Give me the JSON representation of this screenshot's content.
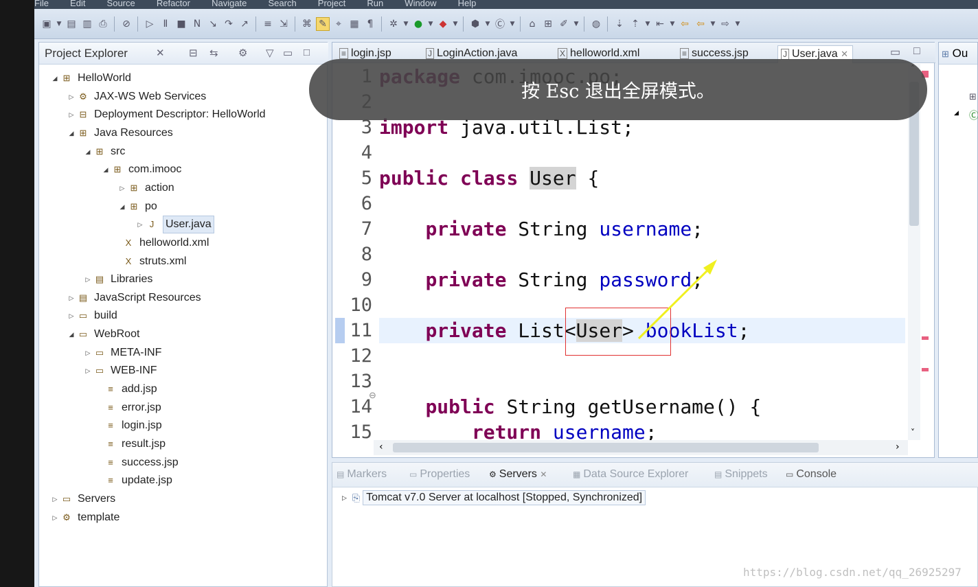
{
  "menubar": {
    "items": [
      "File",
      "Edit",
      "Source",
      "Refactor",
      "Navigate",
      "Search",
      "Project",
      "Run",
      "Window",
      "Help"
    ]
  },
  "project_explorer": {
    "title": "Project Explorer",
    "tree": [
      {
        "label": "HelloWorld",
        "expanded": true
      },
      {
        "label": "JAX-WS Web Services",
        "expanded": false
      },
      {
        "label": "Deployment Descriptor: HelloWorld",
        "expanded": false
      },
      {
        "label": "Java Resources",
        "expanded": true
      },
      {
        "label": "src",
        "expanded": true
      },
      {
        "label": "com.imooc",
        "expanded": true
      },
      {
        "label": "action",
        "expanded": false
      },
      {
        "label": "po",
        "expanded": true
      },
      {
        "label": "User.java",
        "expanded": false,
        "selected": true
      },
      {
        "label": "helloworld.xml"
      },
      {
        "label": "struts.xml"
      },
      {
        "label": "Libraries",
        "expanded": false
      },
      {
        "label": "JavaScript Resources",
        "expanded": false
      },
      {
        "label": "build",
        "expanded": false
      },
      {
        "label": "WebRoot",
        "expanded": true
      },
      {
        "label": "META-INF",
        "expanded": false
      },
      {
        "label": "WEB-INF",
        "expanded": false
      },
      {
        "label": "add.jsp"
      },
      {
        "label": "error.jsp"
      },
      {
        "label": "login.jsp"
      },
      {
        "label": "result.jsp"
      },
      {
        "label": "success.jsp"
      },
      {
        "label": "update.jsp"
      },
      {
        "label": "Servers",
        "expanded": false
      },
      {
        "label": "template",
        "expanded": false
      }
    ]
  },
  "editor": {
    "tabs": [
      "login.jsp",
      "LoginAction.java",
      "helloworld.xml",
      "success.jsp",
      "User.java"
    ],
    "active_tab": "User.java",
    "line_numbers": [
      "1",
      "2",
      "3",
      "4",
      "5",
      "6",
      "7",
      "8",
      "9",
      "10",
      "11",
      "12",
      "13",
      "14",
      "15"
    ],
    "lines": [
      {
        "n": "1",
        "parts": [
          [
            "kw",
            "package"
          ],
          [
            "t",
            " com.imooc.po;"
          ]
        ]
      },
      {
        "n": "2",
        "parts": []
      },
      {
        "n": "3",
        "parts": [
          [
            "kw",
            "import"
          ],
          [
            "t",
            " java.util.List;"
          ]
        ]
      },
      {
        "n": "4",
        "parts": []
      },
      {
        "n": "5",
        "parts": [
          [
            "kw",
            "public"
          ],
          [
            "t",
            " "
          ],
          [
            "kw",
            "class"
          ],
          [
            "t",
            " "
          ],
          [
            "occ",
            "User"
          ],
          [
            "t",
            " {"
          ]
        ]
      },
      {
        "n": "6",
        "parts": []
      },
      {
        "n": "7",
        "parts": [
          [
            "t",
            "    "
          ],
          [
            "kw",
            "private"
          ],
          [
            "t",
            " String "
          ],
          [
            "fld",
            "username"
          ],
          [
            "t",
            ";"
          ]
        ]
      },
      {
        "n": "8",
        "parts": []
      },
      {
        "n": "9",
        "parts": [
          [
            "t",
            "    "
          ],
          [
            "kw",
            "private"
          ],
          [
            "t",
            " String "
          ],
          [
            "fld",
            "password"
          ],
          [
            "t",
            ";"
          ]
        ]
      },
      {
        "n": "10",
        "parts": []
      },
      {
        "n": "11",
        "parts": [
          [
            "t",
            "    "
          ],
          [
            "kw",
            "private"
          ],
          [
            "t",
            " List<"
          ],
          [
            "occ",
            "User"
          ],
          [
            "t",
            "> "
          ],
          [
            "fld",
            "bookList"
          ],
          [
            "t",
            ";"
          ]
        ]
      },
      {
        "n": "12",
        "parts": []
      },
      {
        "n": "13",
        "parts": []
      },
      {
        "n": "14",
        "parts": [
          [
            "t",
            "    "
          ],
          [
            "kw",
            "public"
          ],
          [
            "t",
            " String getUsername() {"
          ]
        ]
      },
      {
        "n": "15",
        "parts": [
          [
            "t",
            "        "
          ],
          [
            "kw",
            "return"
          ],
          [
            "t",
            " "
          ],
          [
            "fld",
            "username"
          ],
          [
            "t",
            ";"
          ]
        ]
      }
    ]
  },
  "outline": {
    "title": "Ou"
  },
  "bottom_panel": {
    "tabs": [
      "Markers",
      "Properties",
      "Servers",
      "Data Source Explorer",
      "Snippets",
      "Console"
    ],
    "active_tab": "Servers",
    "server": "Tomcat v7.0 Server at localhost  [Stopped, Synchronized]"
  },
  "overlay": {
    "toast": "按 Esc 退出全屏模式。"
  },
  "watermark": "https://blog.csdn.net/qq_26925297",
  "colors": {
    "keyword": "#7f0055",
    "field": "#0000c0",
    "current_line": "#e8f2fe",
    "annotation_box": "#e03030",
    "arrow": "#f0f020"
  }
}
